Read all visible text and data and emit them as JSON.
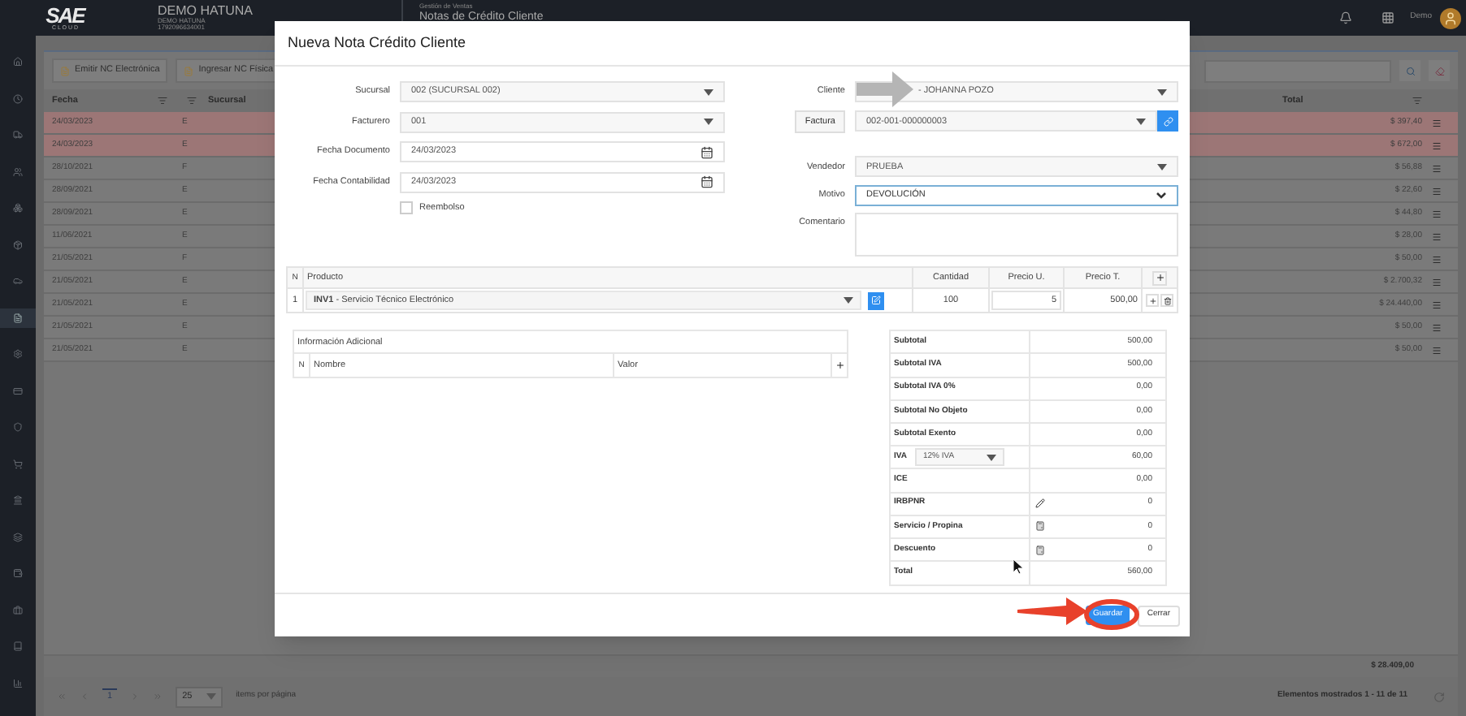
{
  "header": {
    "logo": "SAE",
    "logo_sub": "C L O U D",
    "company": "DEMO HATUNA",
    "company_sub": "DEMO HATUNA",
    "company_id": "1792096634001",
    "module": "Gestión de Ventas",
    "page_title": "Notas de Crédito Cliente",
    "user": "Demo"
  },
  "sidebar": {
    "items": [
      {
        "selected": false
      },
      {
        "selected": false
      },
      {
        "selected": false
      },
      {
        "selected": false
      },
      {
        "selected": false
      },
      {
        "selected": false
      },
      {
        "selected": false
      },
      {
        "selected": true
      },
      {
        "selected": false
      },
      {
        "selected": false
      },
      {
        "selected": false
      },
      {
        "selected": false
      },
      {
        "selected": false
      },
      {
        "selected": false
      },
      {
        "selected": false
      },
      {
        "selected": false
      },
      {
        "selected": false
      },
      {
        "selected": false
      }
    ]
  },
  "toolbar": {
    "buttons": [
      "Emitir NC Electrónica",
      "Ingresar NC Física"
    ]
  },
  "table": {
    "columns": [
      "Fecha",
      "Sucursal",
      "Total"
    ],
    "rows": [
      {
        "fecha": "24/03/2023",
        "tipo": "E",
        "total": "$ 397,40",
        "highlighted": true
      },
      {
        "fecha": "24/03/2023",
        "tipo": "E",
        "total": "$ 672,00",
        "highlighted": true
      },
      {
        "fecha": "28/10/2021",
        "tipo": "F",
        "total": "$ 56,88",
        "highlighted": false
      },
      {
        "fecha": "28/09/2021",
        "tipo": "E",
        "total": "$ 22,60",
        "highlighted": false
      },
      {
        "fecha": "28/09/2021",
        "tipo": "E",
        "total": "$ 44,80",
        "highlighted": false
      },
      {
        "fecha": "11/06/2021",
        "tipo": "E",
        "total": "$ 28,00",
        "highlighted": false
      },
      {
        "fecha": "21/05/2021",
        "tipo": "F",
        "total": "$ 50,00",
        "highlighted": false
      },
      {
        "fecha": "21/05/2021",
        "tipo": "E",
        "total": "$ 2.700,32",
        "highlighted": false
      },
      {
        "fecha": "21/05/2021",
        "tipo": "E",
        "total": "$ 24.440,00",
        "highlighted": false
      },
      {
        "fecha": "21/05/2021",
        "tipo": "E",
        "total": "$ 50,00",
        "highlighted": false
      },
      {
        "fecha": "21/05/2021",
        "tipo": "E",
        "total": "$ 50,00",
        "highlighted": false
      }
    ],
    "grand_total": "$ 28.409,00"
  },
  "pagination": {
    "page": "1",
    "page_size": "25",
    "page_size_label": "items por página",
    "summary": "Elementos mostrados 1 - 11 de 11"
  },
  "modal": {
    "title": "Nueva Nota Crédito Cliente",
    "left_fields": [
      {
        "label": "Sucursal",
        "value": "002 (SUCURSAL 002)",
        "kind": "select"
      },
      {
        "label": "Facturero",
        "value": "001",
        "kind": "select"
      },
      {
        "label": "Fecha Documento",
        "value": "24/03/2023",
        "kind": "date"
      },
      {
        "label": "Fecha Contabilidad",
        "value": "24/03/2023",
        "kind": "date"
      }
    ],
    "reembolso": {
      "label": "Reembolso",
      "checked": false
    },
    "right_fields": [
      {
        "label": "Cliente",
        "value": "- JOHANNA POZO",
        "kind": "select"
      },
      {
        "label": "Factura",
        "value": "002-001-000000003",
        "kind": "select-button"
      },
      {
        "label": "Vendedor",
        "value": "PRUEBA",
        "kind": "select"
      },
      {
        "label": "Motivo",
        "value": "DEVOLUCIÓN",
        "kind": "focused"
      },
      {
        "label": "Comentario",
        "kind": "textarea"
      }
    ],
    "products": {
      "columns": [
        "N",
        "Producto",
        "Cantidad",
        "Precio U.",
        "Precio T."
      ],
      "rows": [
        {
          "n": "1",
          "product": "**INV1** - Servicio Técnico Electrónico",
          "cantidad": "100",
          "precio_u": "5",
          "precio_t": "500,00"
        }
      ]
    },
    "additional": {
      "title": "Información Adicional",
      "columns": [
        "N",
        "Nombre",
        "Valor"
      ]
    },
    "totals": [
      {
        "label": "Subtotal",
        "value": "500,00",
        "kind": "plain"
      },
      {
        "label": "Subtotal IVA",
        "value": "500,00",
        "kind": "plain"
      },
      {
        "label": "Subtotal IVA 0%",
        "value": "0,00",
        "kind": "plain"
      },
      {
        "label": "Subtotal No Objeto",
        "value": "0,00",
        "kind": "plain"
      },
      {
        "label": "Subtotal Exento",
        "value": "0,00",
        "kind": "plain"
      },
      {
        "label": "IVA",
        "value": "60,00",
        "kind": "select",
        "option": "12% IVA"
      },
      {
        "label": "ICE",
        "value": "0,00",
        "kind": "plain"
      },
      {
        "label": "IRBPNR",
        "value": "0",
        "kind": "edit"
      },
      {
        "label": "Servicio / Propina",
        "value": "0",
        "kind": "calc"
      },
      {
        "label": "Descuento",
        "value": "0",
        "kind": "calc"
      },
      {
        "label": "Total",
        "value": "560,00",
        "kind": "plain"
      }
    ],
    "buttons": [
      {
        "label": "Guardar",
        "kind": "primary"
      },
      {
        "label": "Cerrar",
        "kind": "secondary"
      }
    ]
  }
}
